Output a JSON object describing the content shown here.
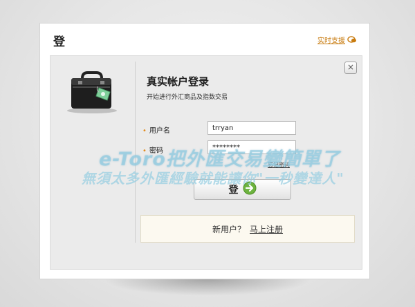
{
  "dialog": {
    "title": "登",
    "support_link": "实时支援",
    "close_glyph": "×"
  },
  "login": {
    "heading": "真实帐户登录",
    "subheading": "开始进行外汇商品及指数交易",
    "username_label": "用户名",
    "username_value": "trryan",
    "password_label": "密码",
    "password_value": "********",
    "required_marker": "•",
    "forgot_link": "忘记密码",
    "button_label": "登"
  },
  "signup": {
    "question": "新用户？",
    "register_link": "马上注册"
  },
  "watermark": {
    "line1": "e-Toro把外匯交易變簡單了",
    "line2": "無須太多外匯經驗就能讓你\"一秒變達人\""
  },
  "colors": {
    "accent_orange": "#c87b0f",
    "button_arrow_green": "#6db33f"
  }
}
